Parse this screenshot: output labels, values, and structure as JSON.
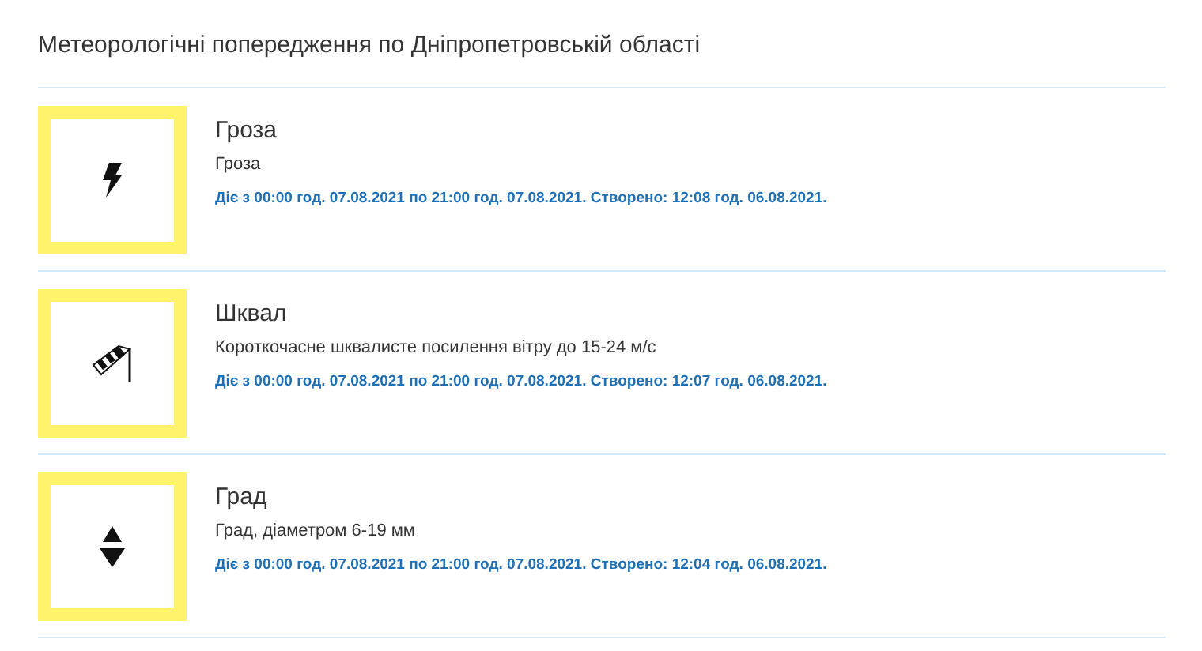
{
  "title": "Метеорологічні попередження по Дніпропетровській області",
  "warnings": [
    {
      "kind": "thunderstorm",
      "name": "Гроза",
      "description": "Гроза",
      "period": "Діє з 00:00 год. 07.08.2021 по 21:00 год. 07.08.2021. Створено: 12:08 год. 06.08.2021."
    },
    {
      "kind": "squall",
      "name": "Шквал",
      "description": "Короткочасне шквалисте посилення вітру до 15-24 м/с",
      "period": "Діє з 00:00 год. 07.08.2021 по 21:00 год. 07.08.2021. Створено: 12:07 год. 06.08.2021."
    },
    {
      "kind": "hail",
      "name": "Град",
      "description": "Град, діаметром 6-19 мм",
      "period": "Діє з 00:00 год. 07.08.2021 по 21:00 год. 07.08.2021. Створено: 12:04 год. 06.08.2021."
    }
  ]
}
